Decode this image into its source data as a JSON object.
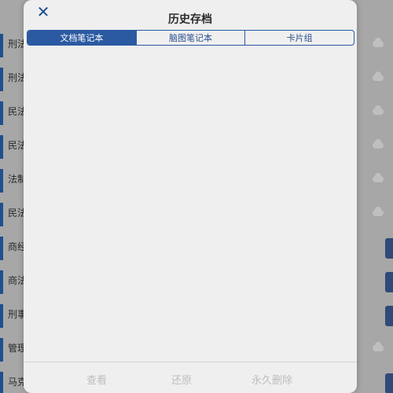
{
  "background": {
    "items": [
      {
        "label": "刑法"
      },
      {
        "label": "刑法"
      },
      {
        "label": "民法"
      },
      {
        "label": "民法"
      },
      {
        "label": "法制"
      },
      {
        "label": "民法"
      },
      {
        "label": "商经"
      },
      {
        "label": "商法"
      },
      {
        "label": "刑事"
      },
      {
        "label": "管理"
      },
      {
        "label": "马克"
      }
    ]
  },
  "modal": {
    "title": "历史存档",
    "tabs": [
      {
        "label": "文档笔记本",
        "active": true
      },
      {
        "label": "脑图笔记本",
        "active": false
      },
      {
        "label": "卡片组",
        "active": false
      }
    ],
    "footer": {
      "view_label": "查看",
      "restore_label": "还原",
      "delete_label": "永久删除"
    }
  },
  "colors": {
    "accent": "#2b5aa2",
    "disabled_text": "#bdbdbd",
    "modal_bg": "#efefef"
  },
  "icons": {
    "close": "close-icon",
    "cloud": "cloud-icon"
  }
}
